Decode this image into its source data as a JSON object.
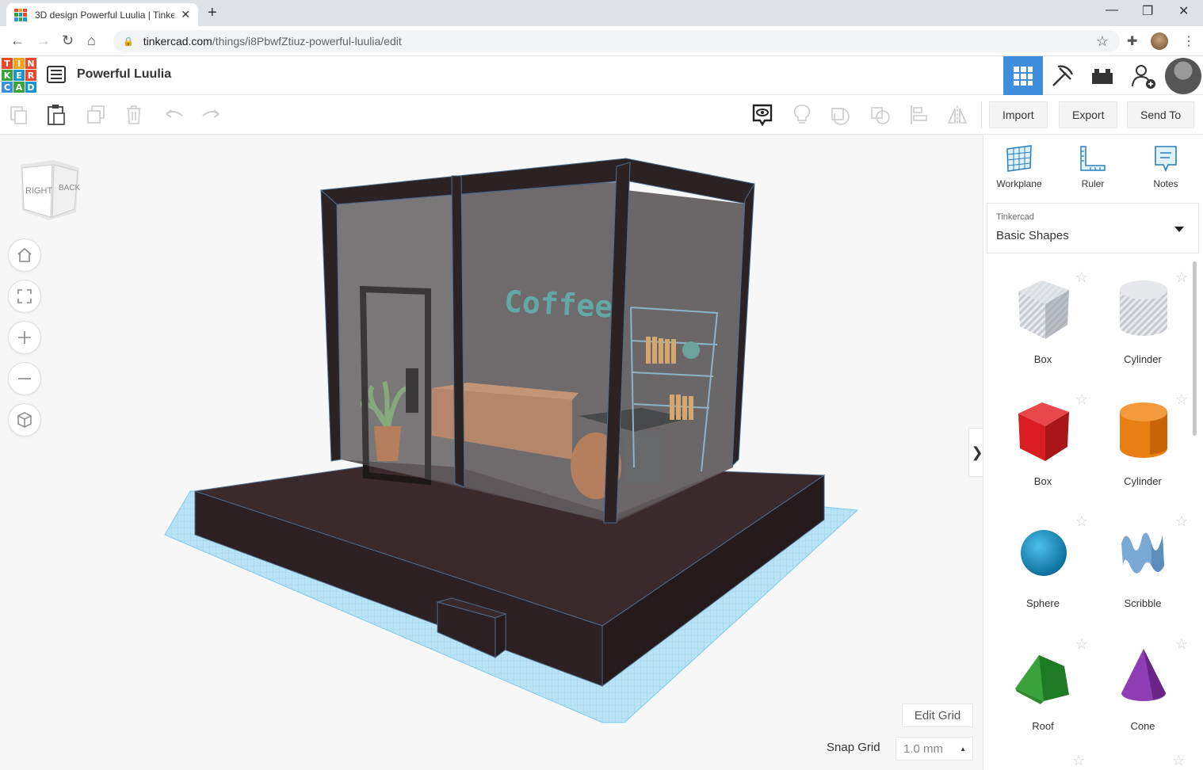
{
  "browser": {
    "tab_title": "3D design Powerful Luulia | Tinkercad",
    "url_host": "tinkercad.com",
    "url_path": "/things/i8PbwfZtiuz-powerful-luulia/edit"
  },
  "app": {
    "logo_letters": [
      "T",
      "I",
      "N",
      "K",
      "E",
      "R",
      "C",
      "A",
      "D"
    ],
    "design_title": "Powerful Luulia"
  },
  "toolbar": {
    "import_label": "Import",
    "export_label": "Export",
    "send_to_label": "Send To"
  },
  "viewcube": {
    "right": "RIGHT",
    "back": "BACK"
  },
  "scene": {
    "sign_text": "Coffee"
  },
  "workspace": {
    "edit_grid_label": "Edit Grid",
    "snap_grid_label": "Snap Grid",
    "snap_grid_value": "1.0 mm"
  },
  "panel": {
    "tools": [
      {
        "label": "Workplane",
        "icon": "workplane-icon"
      },
      {
        "label": "Ruler",
        "icon": "ruler-icon"
      },
      {
        "label": "Notes",
        "icon": "notes-icon"
      }
    ],
    "library_source": "Tinkercad",
    "library_name": "Basic Shapes",
    "shapes": [
      {
        "label": "Box",
        "color": "#b8bcc4"
      },
      {
        "label": "Cylinder",
        "color": "#b8bcc4"
      },
      {
        "label": "Box",
        "color": "#d81e22"
      },
      {
        "label": "Cylinder",
        "color": "#e97e12"
      },
      {
        "label": "Sphere",
        "color": "#1595c9"
      },
      {
        "label": "Scribble",
        "color": "#7aa8d4"
      },
      {
        "label": "Roof",
        "color": "#3aa23a"
      },
      {
        "label": "Cone",
        "color": "#7b2f9e"
      }
    ]
  },
  "colors": {
    "accent": "#3f8edb",
    "logo_colors": [
      "#e8492a",
      "#f4a21c",
      "#e8492a",
      "#3aa23a",
      "#1595c9",
      "#e8492a",
      "#3f8edb",
      "#3aa23a",
      "#1595c9"
    ]
  }
}
